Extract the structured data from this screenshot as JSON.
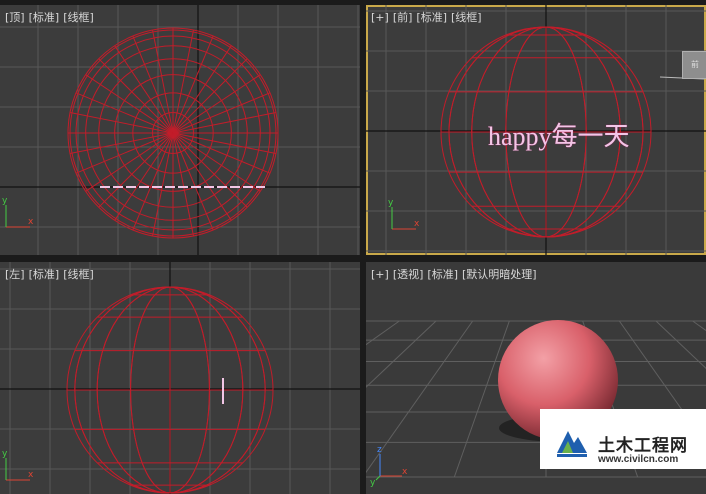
{
  "viewports": {
    "top": {
      "label": [
        "[顶]",
        "[标准]",
        "[线框]"
      ]
    },
    "front": {
      "label": [
        "[+]",
        "[前]",
        "[标准]",
        "[线框]"
      ],
      "viewcube_label": "前"
    },
    "left": {
      "label": [
        "[左]",
        "[标准]",
        "[线框]"
      ]
    },
    "perspective": {
      "label": [
        "[+]",
        "[透视]",
        "[标准]",
        "[默认明暗处理]"
      ]
    }
  },
  "scene_text": "happy每一天",
  "axes": {
    "x": "x",
    "y": "y",
    "z": "z"
  },
  "colors": {
    "viewport_bg": "#3c3c3c",
    "wireframe": "#c21d2a",
    "active_border": "#c9a94a",
    "grid": "#585858",
    "sphere_shaded": "#d9606a"
  },
  "watermark": {
    "name": "土木工程网",
    "url": "www.civilcn.com"
  }
}
